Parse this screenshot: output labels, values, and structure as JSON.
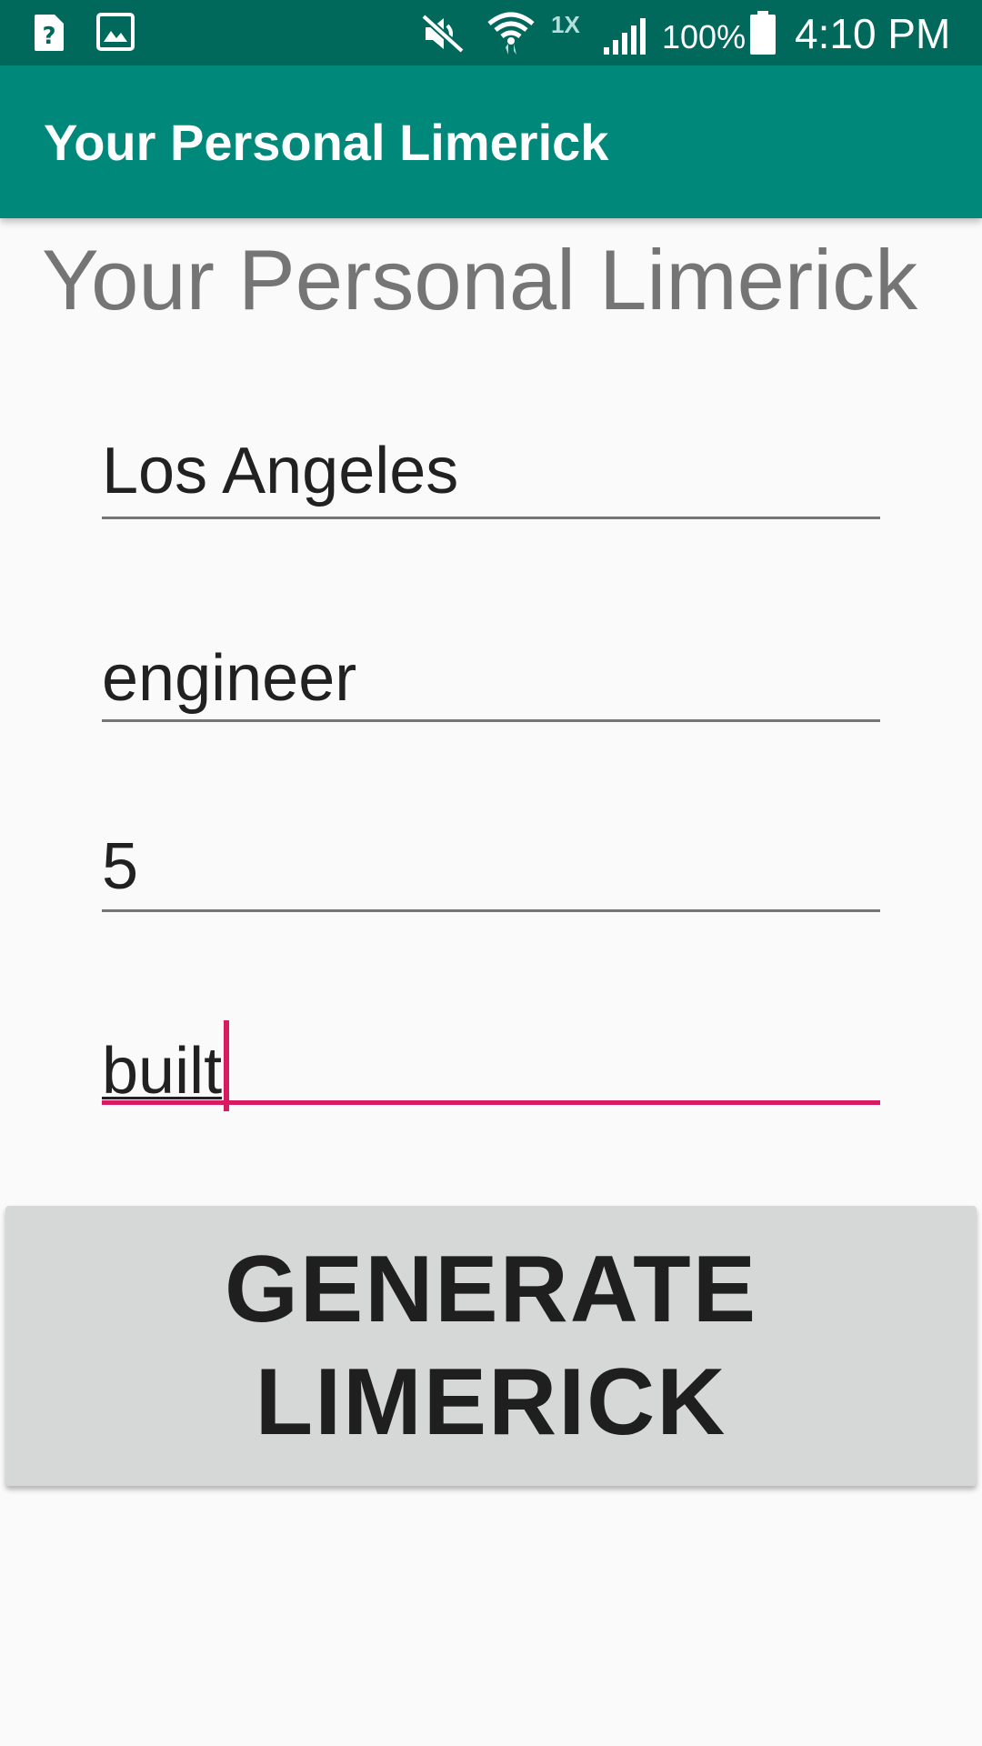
{
  "status_bar": {
    "left_icons": [
      "help-notification-icon",
      "image-notification-icon"
    ],
    "right_icons": [
      "mute-icon",
      "wifi-icon",
      "signal-icon",
      "battery-icon"
    ],
    "network_label": "1X",
    "battery_percent": "100%",
    "time": "4:10 PM"
  },
  "app_bar": {
    "title": "Your Personal Limerick"
  },
  "main": {
    "heading": "Your Personal Limerick",
    "fields": [
      {
        "value": "Los Angeles"
      },
      {
        "value": "engineer"
      },
      {
        "value": "5"
      },
      {
        "value": "built",
        "focused": true
      }
    ],
    "generate_button_label": "GENERATE LIMERICK"
  },
  "colors": {
    "status_bar": "#00695c",
    "app_bar": "#00897b",
    "accent": "#d81b60",
    "button": "#d6d7d7"
  }
}
